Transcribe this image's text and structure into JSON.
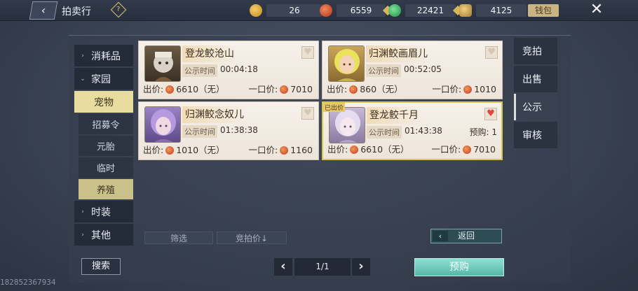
{
  "header": {
    "title": "拍卖行",
    "help": "?",
    "wallet_label": "钱包",
    "currencies": [
      {
        "icon": "gold-ingot-icon",
        "value": "26",
        "color": "#e1a93a"
      },
      {
        "icon": "red-coin-icon",
        "value": "6559",
        "color": "#d2452f"
      },
      {
        "icon": "green-jade-icon",
        "value": "22421",
        "color": "#3fbf6a"
      },
      {
        "icon": "feather-icon",
        "value": "4125",
        "color": "#caa24b"
      }
    ]
  },
  "left_nav": {
    "items": [
      {
        "label": "消耗品"
      },
      {
        "label": "家园"
      },
      {
        "label": "宠物"
      },
      {
        "label": "时装"
      },
      {
        "label": "其他"
      }
    ],
    "pet_sub": [
      "招募令",
      "元胎",
      "临时",
      "养殖"
    ]
  },
  "cards": [
    {
      "name": "登龙鲛沧山",
      "time_label": "公示时间",
      "time": "00:04:18",
      "bid_label": "出价:",
      "bid": "6610（无）",
      "buyout_label": "一口价:",
      "buyout": "7010"
    },
    {
      "name": "归渊鲛画眉儿",
      "time_label": "公示时间",
      "time": "00:52:05",
      "bid_label": "出价:",
      "bid": "860（无）",
      "buyout_label": "一口价:",
      "buyout": "1010"
    },
    {
      "name": "归渊鲛念奴儿",
      "time_label": "公示时间",
      "time": "01:38:38",
      "bid_label": "出价:",
      "bid": "1010（无）",
      "buyout_label": "一口价:",
      "buyout": "1160"
    },
    {
      "name": "登龙鲛千月",
      "time_label": "公示时间",
      "time": "01:43:38",
      "bid_label": "出价:",
      "bid": "6610（无）",
      "buyout_label": "一口价:",
      "buyout": "7010",
      "badge": "已出价",
      "preorder": "预购: 1"
    }
  ],
  "right_tabs": [
    "竞拍",
    "出售",
    "公示",
    "审核"
  ],
  "filters": {
    "filter": "筛选",
    "sort": "竞拍价↓",
    "return": "返回"
  },
  "bottom": {
    "search": "搜索",
    "prev": "‹",
    "page": "1/1",
    "next": "›",
    "preorder": "预购"
  },
  "watermark": "182852367934"
}
